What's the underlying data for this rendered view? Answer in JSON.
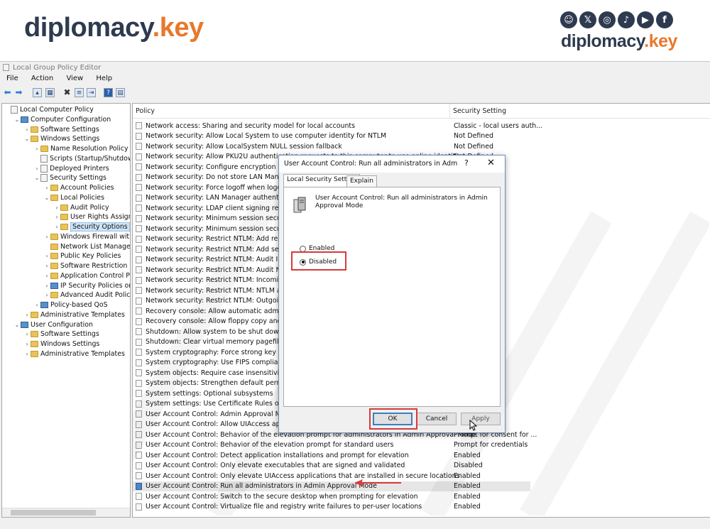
{
  "branding": {
    "left_logo": {
      "part1": "diplomacy",
      "dot": ".",
      "part2": "key"
    },
    "right_logo": {
      "part1": "diplomacy",
      "dot": ".",
      "part2": "key"
    },
    "social_icons": [
      "snapchat-icon",
      "x-icon",
      "instagram-icon",
      "tiktok-icon",
      "youtube-icon",
      "facebook-icon"
    ],
    "social_glyphs": [
      "☺",
      "𝕏",
      "◎",
      "♪",
      "▶",
      "f"
    ],
    "colors": {
      "dark": "#2e3a4f",
      "accent": "#e8782c"
    }
  },
  "window": {
    "title": "Local Group Policy Editor",
    "menu": [
      "File",
      "Action",
      "View",
      "Help"
    ]
  },
  "tree": [
    {
      "label": "Local Computer Policy",
      "indent": 0,
      "exp": "",
      "icon": "pol"
    },
    {
      "label": "Computer Configuration",
      "indent": 1,
      "exp": "⌄",
      "icon": "comp"
    },
    {
      "label": "Software Settings",
      "indent": 2,
      "exp": "›",
      "icon": "fold"
    },
    {
      "label": "Windows Settings",
      "indent": 2,
      "exp": "⌄",
      "icon": "fold"
    },
    {
      "label": "Name Resolution Policy",
      "indent": 3,
      "exp": "›",
      "icon": "fold"
    },
    {
      "label": "Scripts (Startup/Shutdown)",
      "indent": 3,
      "exp": "",
      "icon": "pol"
    },
    {
      "label": "Deployed Printers",
      "indent": 3,
      "exp": "›",
      "icon": "pol"
    },
    {
      "label": "Security Settings",
      "indent": 3,
      "exp": "⌄",
      "icon": "pol"
    },
    {
      "label": "Account Policies",
      "indent": 4,
      "exp": "›",
      "icon": "fold"
    },
    {
      "label": "Local Policies",
      "indent": 4,
      "exp": "⌄",
      "icon": "fold"
    },
    {
      "label": "Audit Policy",
      "indent": 5,
      "exp": "›",
      "icon": "fold"
    },
    {
      "label": "User Rights Assignme",
      "indent": 5,
      "exp": "›",
      "icon": "fold"
    },
    {
      "label": "Security Options",
      "indent": 5,
      "exp": "›",
      "icon": "fold",
      "selected": true
    },
    {
      "label": "Windows Firewall with Ac",
      "indent": 4,
      "exp": "›",
      "icon": "fold"
    },
    {
      "label": "Network List Manager Po",
      "indent": 4,
      "exp": "",
      "icon": "fold"
    },
    {
      "label": "Public Key Policies",
      "indent": 4,
      "exp": "›",
      "icon": "fold"
    },
    {
      "label": "Software Restriction Polic",
      "indent": 4,
      "exp": "›",
      "icon": "fold"
    },
    {
      "label": "Application Control Polic",
      "indent": 4,
      "exp": "›",
      "icon": "fold"
    },
    {
      "label": "IP Security Policies on Lo",
      "indent": 4,
      "exp": "›",
      "icon": "comp"
    },
    {
      "label": "Advanced Audit Policy Co",
      "indent": 4,
      "exp": "›",
      "icon": "fold"
    },
    {
      "label": "Policy-based QoS",
      "indent": 3,
      "exp": "›",
      "icon": "comp"
    },
    {
      "label": "Administrative Templates",
      "indent": 2,
      "exp": "›",
      "icon": "fold"
    },
    {
      "label": "User Configuration",
      "indent": 1,
      "exp": "⌄",
      "icon": "comp"
    },
    {
      "label": "Software Settings",
      "indent": 2,
      "exp": "›",
      "icon": "fold"
    },
    {
      "label": "Windows Settings",
      "indent": 2,
      "exp": "›",
      "icon": "fold"
    },
    {
      "label": "Administrative Templates",
      "indent": 2,
      "exp": "›",
      "icon": "fold"
    }
  ],
  "list": {
    "col_policy": "Policy",
    "col_setting": "Security Setting",
    "rows": [
      {
        "policy": "Network access: Sharing and security model for local accounts",
        "setting": "Classic - local users auth..."
      },
      {
        "policy": "Network security: Allow Local System to use computer identity for NTLM",
        "setting": "Not Defined"
      },
      {
        "policy": "Network security: Allow LocalSystem NULL session fallback",
        "setting": "Not Defined"
      },
      {
        "policy": "Network security: Allow PKU2U authentication requests to this computer to use online identities.",
        "setting": "Not Defined"
      },
      {
        "policy": "Network security: Configure encryption types a",
        "setting": ""
      },
      {
        "policy": "Network security: Do not store LAN Manager ha",
        "setting": ""
      },
      {
        "policy": "Network security: Force logoff when logon hou",
        "setting": ""
      },
      {
        "policy": "Network security: LAN Manager authentication",
        "setting": ""
      },
      {
        "policy": "Network security: LDAP client signing requirem",
        "setting": ""
      },
      {
        "policy": "Network security: Minimum session security fo",
        "setting": "crypti..."
      },
      {
        "policy": "Network security: Minimum session security fo",
        "setting": "crypti..."
      },
      {
        "policy": "Network security: Restrict NTLM: Add remote s",
        "setting": ""
      },
      {
        "policy": "Network security: Restrict NTLM: Add server ex",
        "setting": ""
      },
      {
        "policy": "Network security: Restrict NTLM: Audit Incomin",
        "setting": ""
      },
      {
        "policy": "Network security: Restrict NTLM: Audit NTLM a",
        "setting": ""
      },
      {
        "policy": "Network security: Restrict NTLM: Incoming NTl",
        "setting": ""
      },
      {
        "policy": "Network security: Restrict NTLM: NTLM authen",
        "setting": ""
      },
      {
        "policy": "Network security: Restrict NTLM: Outgoing NTl",
        "setting": ""
      },
      {
        "policy": "Recovery console: Allow automatic administrat",
        "setting": ""
      },
      {
        "policy": "Recovery console: Allow floppy copy and acces",
        "setting": ""
      },
      {
        "policy": "Shutdown: Allow system to be shut down witho",
        "setting": ""
      },
      {
        "policy": "Shutdown: Clear virtual memory pagefile",
        "setting": ""
      },
      {
        "policy": "System cryptography: Force strong key protecti",
        "setting": ""
      },
      {
        "policy": "System cryptography: Use FIPS compliant algor",
        "setting": ""
      },
      {
        "policy": "System objects: Require case insensitivity for no",
        "setting": ""
      },
      {
        "policy": "System objects: Strengthen default permissions",
        "setting": ""
      },
      {
        "policy": "System settings: Optional subsystems",
        "setting": ""
      },
      {
        "policy": "System settings: Use Certificate Rules on Windo",
        "setting": ""
      },
      {
        "policy": "User Account Control: Admin Approval Mode f",
        "setting": ""
      },
      {
        "policy": "User Account Control: Allow UIAccess applicati",
        "setting": ""
      },
      {
        "policy": "User Account Control: Behavior of the elevation prompt for administrators in Admin Approval Mode",
        "setting": "Prompt for consent for ..."
      },
      {
        "policy": "User Account Control: Behavior of the elevation prompt for standard users",
        "setting": "Prompt for credentials"
      },
      {
        "policy": "User Account Control: Detect application installations and prompt for elevation",
        "setting": "Enabled"
      },
      {
        "policy": "User Account Control: Only elevate executables that are signed and validated",
        "setting": "Disabled"
      },
      {
        "policy": "User Account Control: Only elevate UIAccess applications that are installed in secure locations",
        "setting": "Enabled"
      },
      {
        "policy": "User Account Control: Run all administrators in Admin Approval Mode",
        "setting": "Enabled",
        "highlight": true
      },
      {
        "policy": "User Account Control: Switch to the secure desktop when prompting for elevation",
        "setting": "Enabled"
      },
      {
        "policy": "User Account Control: Virtualize file and registry write failures to per-user locations",
        "setting": "Enabled"
      }
    ]
  },
  "dialog": {
    "title": "User Account Control: Run all administrators in Admin Approval Mode Properties",
    "help": "?",
    "close": "✕",
    "tabs": [
      "Local Security Setting",
      "Explain"
    ],
    "description": "User Account Control: Run all administrators in Admin Approval Mode",
    "options": [
      {
        "label": "Enabled",
        "selected": false
      },
      {
        "label": "Disabled",
        "selected": true
      }
    ],
    "buttons": {
      "ok": "OK",
      "cancel": "Cancel",
      "apply": "Apply"
    }
  },
  "annotation_color": "#d83a3a"
}
